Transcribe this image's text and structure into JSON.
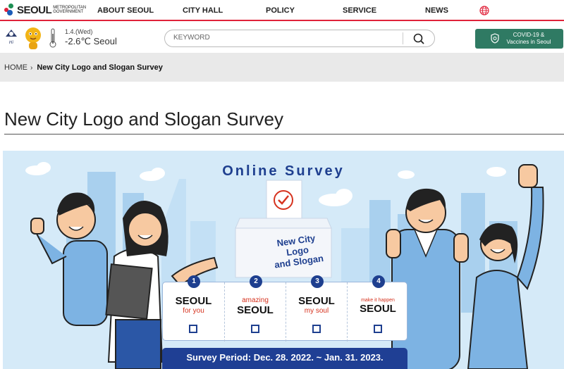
{
  "header": {
    "logo_word": "SEOUL",
    "logo_sub_line1": "METROPOLITAN",
    "logo_sub_line2": "GOVERNMENT",
    "nav": [
      {
        "label": "ABOUT SEOUL"
      },
      {
        "label": "CITY HALL"
      },
      {
        "label": "POLICY"
      },
      {
        "label": "SERVICE"
      },
      {
        "label": "NEWS"
      }
    ],
    "accent_color": "#e0223a"
  },
  "infobar": {
    "date": "1.4.(Wed)",
    "temperature": "-2.6℃ Seoul",
    "search_placeholder": "KEYWORD",
    "covid_line1": "COVID-19 &",
    "covid_line2": "Vaccines in Seoul",
    "covid_color": "#2f7a63"
  },
  "breadcrumb": {
    "home": "HOME",
    "current": "New City Logo and Slogan Survey"
  },
  "page": {
    "title": "New City Logo and Slogan Survey"
  },
  "banner": {
    "heading": "Online Survey",
    "ballot_line1": "New City",
    "ballot_line2": "Logo",
    "ballot_line3": "and Slogan",
    "options": [
      {
        "num": "1",
        "line1": "SEOUL",
        "line2": "for you"
      },
      {
        "num": "2",
        "line1": "amazing",
        "line2": "SEOUL"
      },
      {
        "num": "3",
        "line1": "SEOUL",
        "line2": "my soul"
      },
      {
        "num": "4",
        "line1": "make it happen",
        "line2": "SEOUL"
      }
    ],
    "period": "Survey Period: Dec. 28. 2022. ~ Jan. 31. 2023.",
    "brand_color": "#1e3f8f"
  }
}
